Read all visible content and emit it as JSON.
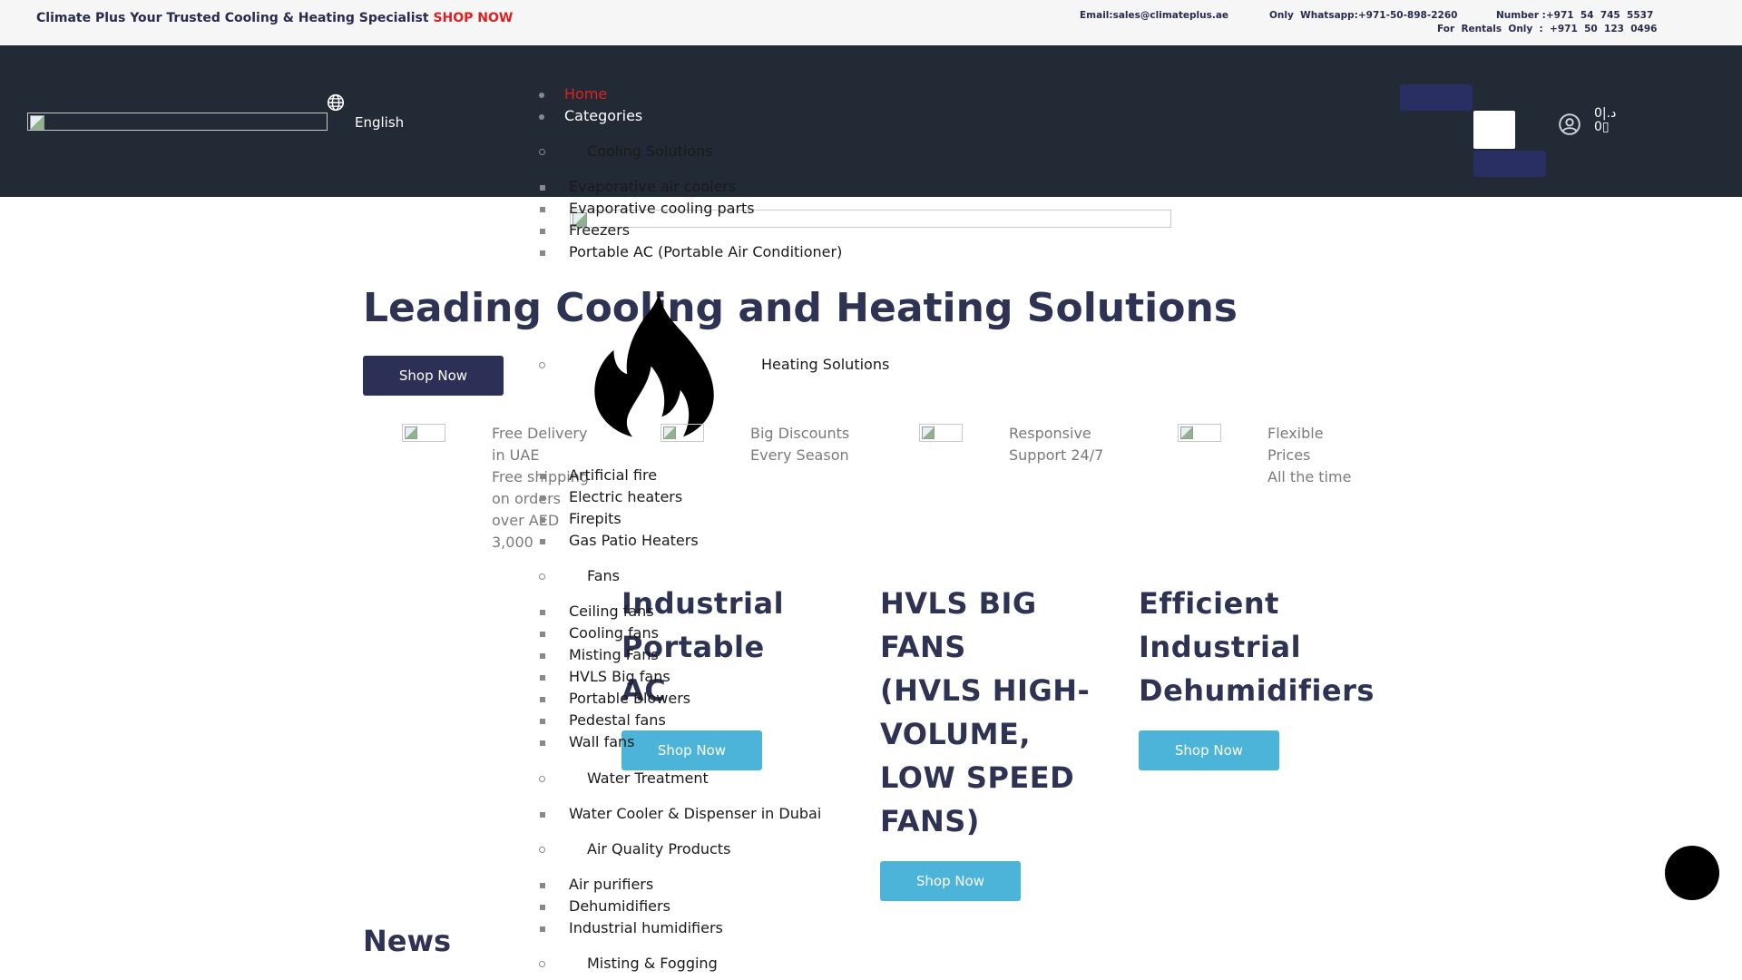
{
  "topbar": {
    "promo": "Climate Plus Your Trusted Cooling & Heating Specialist",
    "shop_now": "SHOP NOW",
    "email": "Email:sales@climateplus.ae",
    "whatsapp": "Only  Whatsapp:+971-50-898-2260",
    "number": "Number :+971  54  745  5537",
    "rentals": "For  Rentals  Only  :  +971  50  123  0496"
  },
  "header": {
    "language": "English",
    "cart_line1": "0|.د",
    "cart_line2": "0▯"
  },
  "nav": {
    "home": "Home",
    "categories": "Categories"
  },
  "categories": {
    "cooling": {
      "title": "Cooling Solutions",
      "items": [
        "Evaporative air coolers",
        "Evaporative cooling parts",
        "Freezers",
        "Portable AC (Portable Air Conditioner)"
      ]
    },
    "heating": {
      "title": "Heating Solutions",
      "items": [
        "Artificial fire",
        "Electric heaters",
        "Firepits",
        "Gas Patio Heaters"
      ]
    },
    "fans": {
      "title": "Fans",
      "items": [
        "Ceiling fans",
        "Cooling fans",
        "Misting Fans",
        "HVLS Big fans",
        "Portable Blowers",
        "Pedestal fans",
        "Wall fans"
      ]
    },
    "water": {
      "title": "Water Treatment",
      "items": [
        "Water Cooler & Dispenser in Dubai"
      ]
    },
    "air": {
      "title": "Air Quality Products",
      "items": [
        "Air purifiers",
        "Dehumidifiers",
        "Industrial humidifiers"
      ]
    },
    "misting": {
      "title": "Misting & Fogging"
    }
  },
  "hero": {
    "title": "Leading Cooling and Heating Solutions",
    "button": "Shop Now"
  },
  "features": [
    {
      "title_line1": "Free Delivery",
      "title_line2": "in UAE",
      "desc": [
        "Free shipping",
        "on orders",
        "over AED",
        "3,000"
      ]
    },
    {
      "title_line1": "Big Discounts",
      "title_line2": "Every Season",
      "desc": []
    },
    {
      "title_line1": "Responsive",
      "title_line2": "Support 24/7",
      "desc": []
    },
    {
      "title_line1": "Flexible",
      "title_line2": "Prices",
      "desc": [
        "All the time"
      ]
    }
  ],
  "cards": [
    {
      "lines": [
        "Industrial",
        "Portable",
        "AC"
      ],
      "button": "Shop Now"
    },
    {
      "lines": [
        "HVLS BIG",
        "FANS",
        "(HVLS HIGH-",
        "VOLUME,",
        "LOW SPEED",
        "FANS)"
      ],
      "button": "Shop Now"
    },
    {
      "lines": [
        "Efficient",
        "Industrial",
        "Dehumidifiers"
      ],
      "button": "Shop Now"
    }
  ],
  "news": {
    "title": "News"
  },
  "colors": {
    "header_bg": "#222a35",
    "brand_navy": "#2e3354",
    "accent_red": "#e02020",
    "button_blue": "#4cb3d9"
  }
}
